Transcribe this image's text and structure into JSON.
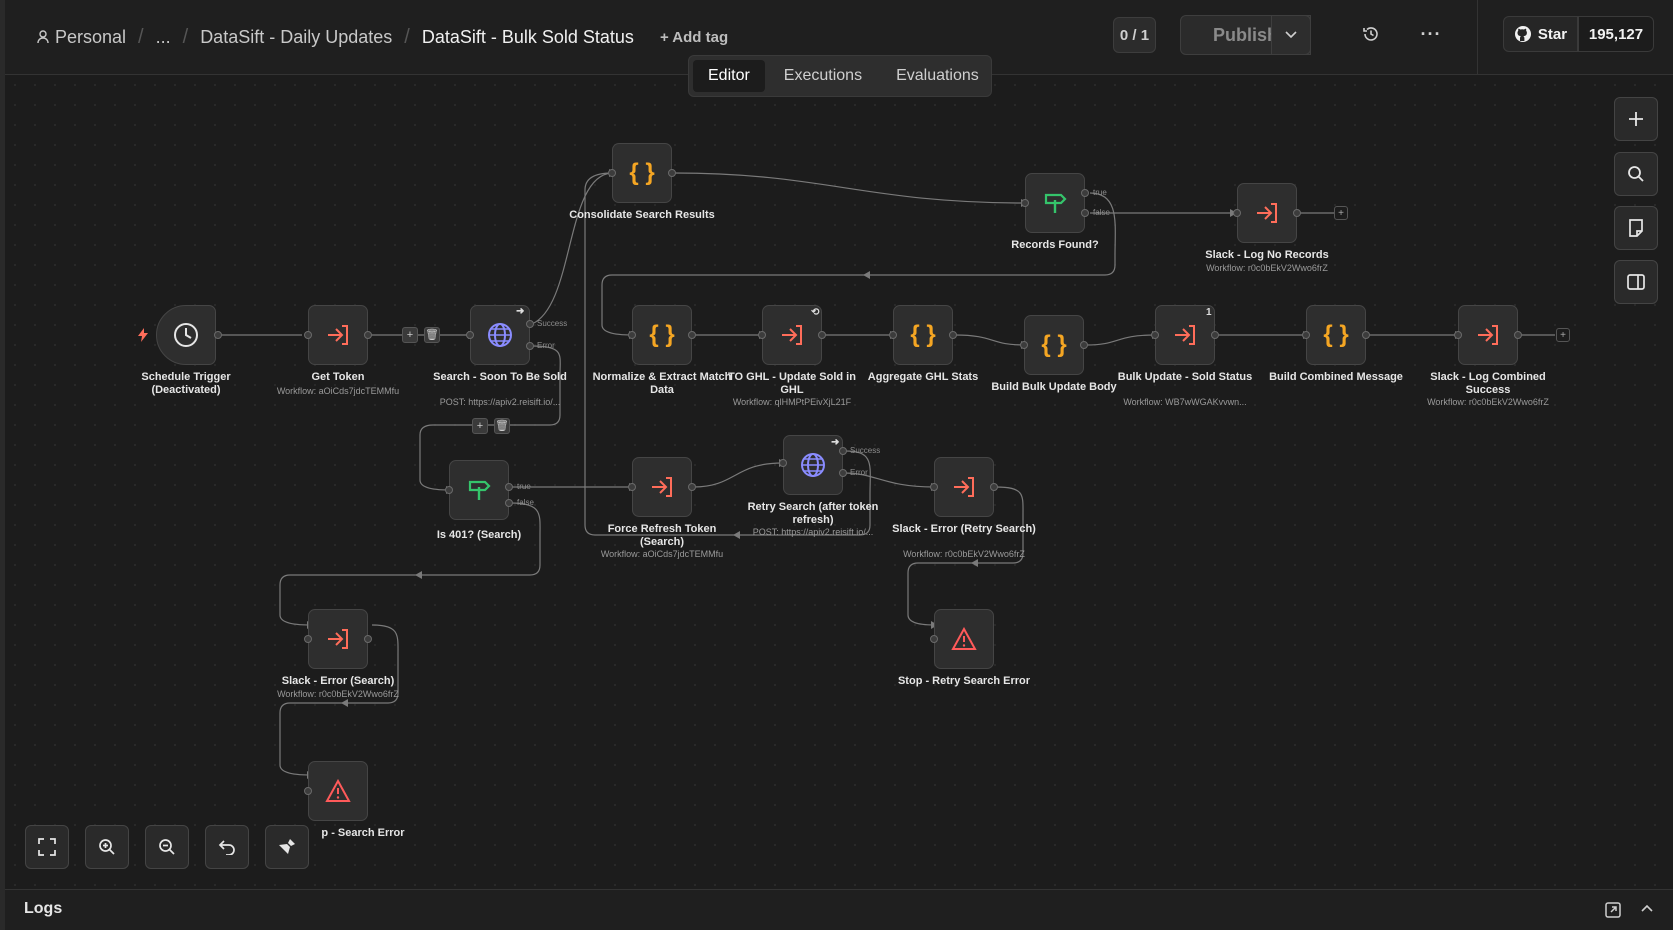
{
  "breadcrumb": {
    "owner": "Personal",
    "ellipsis": "...",
    "parent": "DataSift - Daily Updates",
    "current": "DataSift - Bulk Sold Status",
    "add_tag": "+ Add tag"
  },
  "header": {
    "counter": "0 / 1",
    "publish_label": "Publish",
    "star_label": "Star",
    "star_count": "195,127"
  },
  "tabs": [
    {
      "label": "Editor",
      "active": true
    },
    {
      "label": "Executions",
      "active": false
    },
    {
      "label": "Evaluations",
      "active": false
    }
  ],
  "nodes": {
    "schedule_trigger": {
      "label": "Schedule Trigger (Deactivated)",
      "icon": "clock-icon"
    },
    "get_token": {
      "label": "Get Token",
      "sub": "Workflow: aOiCds7jdcTEMMfu",
      "icon": "execute-workflow-icon"
    },
    "search_soon_sold": {
      "label": "Search - Soon To Be Sold",
      "sub": "POST: https://apiv2.reisift.io/...",
      "icon": "globe-icon",
      "out_success": "Success",
      "out_error": "Error"
    },
    "consolidate": {
      "label": "Consolidate Search Results",
      "icon": "code-braces-icon"
    },
    "records_found": {
      "label": "Records Found?",
      "icon": "if-signpost-icon",
      "out_true": "true",
      "out_false": "false"
    },
    "slack_no_records": {
      "label": "Slack - Log No Records",
      "sub": "Workflow: r0c0bEkV2Wwo6frZ",
      "icon": "execute-workflow-icon"
    },
    "normalize": {
      "label": "Normalize & Extract Match Data",
      "icon": "code-braces-icon"
    },
    "to_ghl": {
      "label": "TO GHL - Update Sold in GHL",
      "sub": "Workflow: qlHMPtPEivXjL21F",
      "icon": "execute-workflow-icon"
    },
    "aggregate": {
      "label": "Aggregate GHL Stats",
      "icon": "code-braces-icon"
    },
    "build_bulk": {
      "label": "Build Bulk Update Body",
      "icon": "code-braces-icon"
    },
    "bulk_update": {
      "label": "Bulk Update - Sold Status",
      "sub": "Workflow: WB7wWGAKvvwn...",
      "icon": "execute-workflow-icon",
      "badge": "1"
    },
    "build_combined": {
      "label": "Build Combined Message",
      "icon": "code-braces-icon"
    },
    "slack_combined": {
      "label": "Slack - Log Combined Success",
      "sub": "Workflow: r0c0bEkV2Wwo6frZ",
      "icon": "execute-workflow-icon"
    },
    "is401": {
      "label": "Is 401? (Search)",
      "icon": "if-signpost-icon",
      "out_true": "true",
      "out_false": "false"
    },
    "force_refresh": {
      "label": "Force Refresh Token (Search)",
      "sub": "Workflow: aOiCds7jdcTEMMfu",
      "icon": "execute-workflow-icon"
    },
    "retry_search": {
      "label": "Retry Search (after token refresh)",
      "sub": "POST: https://apiv2.reisift.io/...",
      "icon": "globe-icon",
      "out_success": "Success",
      "out_error": "Error"
    },
    "slack_err_retry": {
      "label": "Slack - Error (Retry Search)",
      "sub": "Workflow: r0c0bEkV2Wwo6frZ",
      "icon": "execute-workflow-icon"
    },
    "stop_retry": {
      "label": "Stop - Retry Search Error",
      "icon": "warning-triangle-icon"
    },
    "slack_err_search": {
      "label": "Slack - Error (Search)",
      "sub": "Workflow: r0c0bEkV2Wwo6frZ",
      "icon": "execute-workflow-icon"
    },
    "stop_search": {
      "label": "p - Search Error",
      "icon": "warning-triangle-icon"
    }
  },
  "logs": {
    "title": "Logs"
  },
  "colors": {
    "accent_orange": "#ff6d5a",
    "code_orange": "#f5a623",
    "if_green": "#35c46b",
    "http_purple": "#8a8cff",
    "warning_red": "#ff5a5a"
  }
}
